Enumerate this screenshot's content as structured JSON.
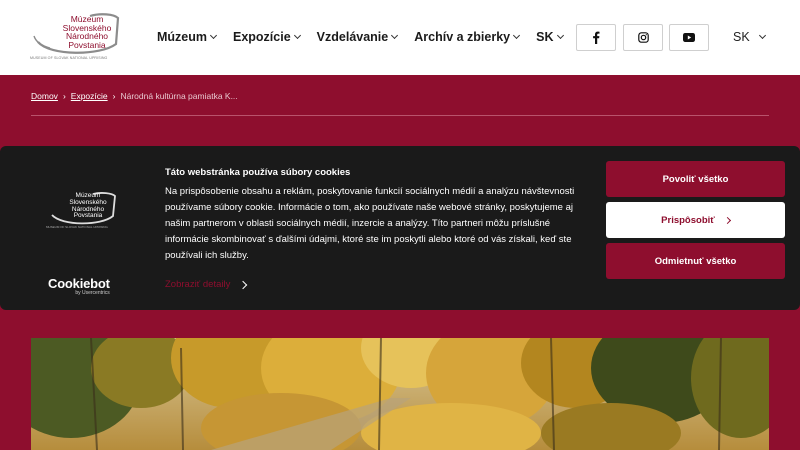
{
  "header": {
    "logo_lines": [
      "Múzeum",
      "Slovenského",
      "Národného",
      "Povstania"
    ],
    "logo_subtitle": "MUSEUM OF SLOVAK NATIONAL UPRISING",
    "nav": [
      {
        "label": "Múzeum"
      },
      {
        "label": "Expozície"
      },
      {
        "label": "Vzdelávanie"
      },
      {
        "label": "Archív a zbierky"
      },
      {
        "label": "SK"
      }
    ],
    "social": [
      "facebook-icon",
      "instagram-icon",
      "youtube-icon"
    ],
    "language": "SK"
  },
  "breadcrumb": {
    "home": "Domov",
    "section": "Expozície",
    "current": "Národná kultúrna pamiatka K..."
  },
  "cookie": {
    "title": "Táto webstránka používa súbory cookies",
    "body": "Na prispôsobenie obsahu a reklám, poskytovanie funkcií sociálnych médií a analýzu návštevnosti používame súbory cookie. Informácie o tom, ako používate naše webové stránky, poskytujeme aj našim partnerom v oblasti sociálnych médií, inzercie a analýzy. Títo partneri môžu príslušné informácie skombinovať s ďalšími údajmi, ktoré ste im poskytli alebo ktoré od vás získali, keď ste používali ich služby.",
    "details_link": "Zobraziť detaily",
    "allow_all": "Povoliť všetko",
    "customize": "Prispôsobiť",
    "deny_all": "Odmietnuť všetko",
    "brand": "Cookiebot",
    "brand_sub": "by Usercentrics"
  },
  "colors": {
    "brand": "#8e0e2e",
    "dialog_bg": "#1a1a1a",
    "header_bg": "#ffffff"
  }
}
